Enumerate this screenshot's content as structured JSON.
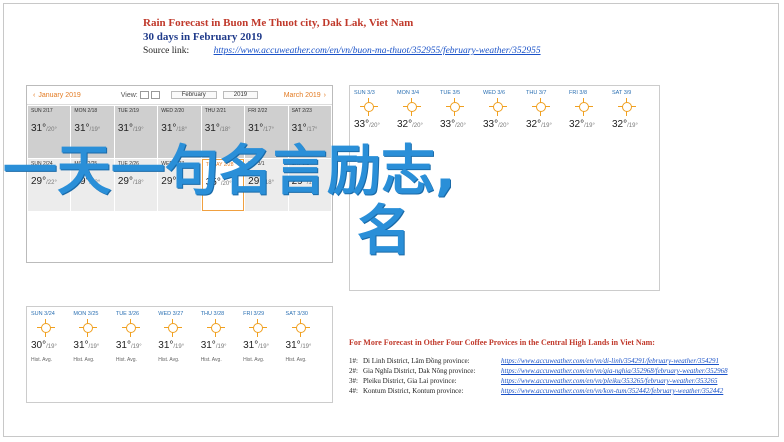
{
  "header": {
    "title": "Rain Forecast in Buon Me Thuot city, Dak Lak, Viet Nam",
    "subtitle": "30 days in February 2019",
    "source_label": "Source link:",
    "source_url": "https://www.accuweather.com/en/vn/buon-ma-thuot/352955/february-weather/352955"
  },
  "calendar": {
    "prev_month": "January 2019",
    "view_label": "View:",
    "month_select": "February",
    "year_select": "2019",
    "next_month": "March 2019",
    "row1": [
      {
        "day": "SUN 2/17",
        "temp": "31°",
        "low": "/20°"
      },
      {
        "day": "MON 2/18",
        "temp": "31°",
        "low": "/19°"
      },
      {
        "day": "TUE 2/19",
        "temp": "31°",
        "low": "/19°"
      },
      {
        "day": "WED 2/20",
        "temp": "31°",
        "low": "/18°"
      },
      {
        "day": "THU 2/21",
        "temp": "31°",
        "low": "/18°"
      },
      {
        "day": "FRI 2/22",
        "temp": "31°",
        "low": "/17°"
      },
      {
        "day": "SAT 2/23",
        "temp": "31°",
        "low": "/17°"
      }
    ],
    "row2": [
      {
        "day": "SUN 2/24",
        "temp": "29°",
        "low": "/22°"
      },
      {
        "day": "MON 2/25",
        "temp": "29°",
        "low": "/18°"
      },
      {
        "day": "TUE 2/26",
        "temp": "29°",
        "low": "/18°"
      },
      {
        "day": "WED 2/27",
        "temp": "29°",
        "low": "/19°"
      },
      {
        "day": "TODAY 2/28",
        "temp": "35°",
        "low": "/20°"
      },
      {
        "day": "FRI 3/1",
        "temp": "29°",
        "low": "/18°"
      },
      {
        "day": "SAT 3/2",
        "temp": "29°",
        "low": "/18°"
      }
    ]
  },
  "forecast_top": [
    {
      "day": "SUN 3/3",
      "hi": "33°",
      "lo": "/20°"
    },
    {
      "day": "MON 3/4",
      "hi": "32°",
      "lo": "/20°"
    },
    {
      "day": "TUE 3/5",
      "hi": "33°",
      "lo": "/20°"
    },
    {
      "day": "WED 3/6",
      "hi": "33°",
      "lo": "/20°"
    },
    {
      "day": "THU 3/7",
      "hi": "32°",
      "lo": "/19°"
    },
    {
      "day": "FRI 3/8",
      "hi": "32°",
      "lo": "/19°"
    },
    {
      "day": "SAT 3/9",
      "hi": "32°",
      "lo": "/19°"
    }
  ],
  "forecast_bottom": [
    {
      "day": "SUN 3/24",
      "hi": "30°",
      "lo": "/19°",
      "cond": "Hist. Avg."
    },
    {
      "day": "MON 3/25",
      "hi": "31°",
      "lo": "/19°",
      "cond": "Hist. Avg."
    },
    {
      "day": "TUE 3/26",
      "hi": "31°",
      "lo": "/19°",
      "cond": "Hist. Avg."
    },
    {
      "day": "WED 3/27",
      "hi": "31°",
      "lo": "/19°",
      "cond": "Hist. Avg."
    },
    {
      "day": "THU 3/28",
      "hi": "31°",
      "lo": "/19°",
      "cond": "Hist. Avg."
    },
    {
      "day": "FRI 3/29",
      "hi": "31°",
      "lo": "/19°",
      "cond": "Hist. Avg."
    },
    {
      "day": "SAT 3/30",
      "hi": "31°",
      "lo": "/19°",
      "cond": "Hist. Avg."
    }
  ],
  "more": {
    "title": "For More Forecast in Other Four Coffee Provices in the Central High Lands in Viet Nam:",
    "rows": [
      {
        "n": "1#:",
        "place": "Di Linh District, Lâm Đồng province:",
        "url": "https://www.accuweather.com/en/vn/di-linh/354291/february-weather/354291"
      },
      {
        "n": "2#:",
        "place": "Gia Nghĩa District, Dak Nông province:",
        "url": "https://www.accuweather.com/en/vn/gia-nghia/352968/february-weather/352968"
      },
      {
        "n": "3#:",
        "place": "Pleiku District, Gia Lai province:",
        "url": "https://www.accuweather.com/en/vn/pleiku/353265/february-weather/353265"
      },
      {
        "n": "4#:",
        "place": "Kontum District, Kontum province:",
        "url": "https://www.accuweather.com/en/vn/kon-tum/352442/february-weather/352442"
      }
    ]
  },
  "overlay": {
    "line1": "一天一句名言励志,",
    "line2": "名"
  }
}
